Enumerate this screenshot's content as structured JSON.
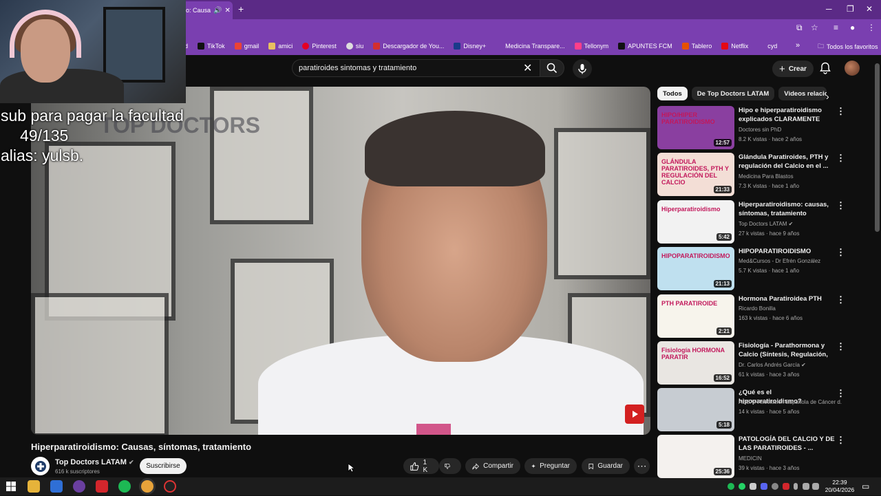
{
  "browser": {
    "tab_title": "o: Causa",
    "bookmarks": [
      "d",
      "TikTok",
      "gmail",
      "amici",
      "Pinterest",
      "siu",
      "Descargador de You...",
      "Disney+",
      "Medicina Transpare...",
      "Tellonym",
      "APUNTES FCM",
      "Tablero",
      "Netflix",
      "cyd"
    ],
    "all_bookmarks": "Todos los favoritos"
  },
  "header": {
    "search_value": "paratiroides sintomas y tratamiento",
    "create_label": "Crear"
  },
  "overlay": {
    "line1": "sub para pagar la facultad",
    "line2": "49/135",
    "line3": "alias: yulsb."
  },
  "video": {
    "watermark": "TOP DOCTORS",
    "title": "Hiperparatiroidismo: Causas, síntomas, tratamiento",
    "channel": "Top Doctors LATAM",
    "subscribers": "616 k suscriptores",
    "subscribe_label": "Suscribirse",
    "likes": "1 K",
    "share_label": "Compartir",
    "ask_label": "Preguntar",
    "save_label": "Guardar"
  },
  "sidebar": {
    "chips": [
      "Todos",
      "De Top Doctors LATAM",
      "Videos relacio"
    ],
    "recommendations": [
      {
        "title": "Hipo e hiperparatiroidismo explicados CLARAMENTE",
        "channel": "Doctores sin PhD",
        "meta": "8.2 K vistas · hace 2 años",
        "duration": "12:57",
        "thumb_text": "HIPO/HIPER PARATIROIDISMO",
        "color": "#8a3fa0"
      },
      {
        "title": "Glándula Paratiroides, PTH y regulación del Calcio en el ...",
        "channel": "Medicina Para Blastos",
        "meta": "7.3 K vistas · hace 1 año",
        "duration": "21:33",
        "thumb_text": "GLÁNDULA PARATIROIDES, PTH Y REGULACIÓN DEL CALCIO",
        "color": "#f3ded6"
      },
      {
        "title": "Hiperparatiroidismo: causas, síntomas, tratamiento",
        "channel": "Top Doctors LATAM",
        "meta": "27 k vistas · hace 9 años",
        "duration": "5:42",
        "thumb_text": "Hiperparatiroidismo",
        "color": "#f2f2f2",
        "verified": true
      },
      {
        "title": "HIPOPARATIROIDISMO",
        "channel": "Med&Cursos - Dr Efrén González",
        "meta": "5.7 K vistas · hace 1 año",
        "duration": "21:13",
        "thumb_text": "HIPOPARATIROIDISMO",
        "color": "#bfe0ef"
      },
      {
        "title": "Hormona Paratiroidea PTH",
        "channel": "Ricardo Bonilla",
        "meta": "163 k vistas · hace 6 años",
        "duration": "2:21",
        "thumb_text": "PTH PARATIROIDE",
        "color": "#f7f4ec"
      },
      {
        "title": "Fisiología - Parathormona y Calcio (Síntesis, Regulación, ...",
        "channel": "Dr. Carlos Andrés García",
        "meta": "61 k vistas · hace 3 años",
        "duration": "16:52",
        "thumb_text": "Fisiología HORMONA PARATIR",
        "color": "#e9e6e2",
        "verified": true
      },
      {
        "title": "¿Qué es el hipoparatiroidismo?",
        "channel": "AECAT Asociación Española de Cáncer d...",
        "meta": "14 k vistas · hace 5 años",
        "duration": "5:18",
        "thumb_text": "",
        "color": "#c7ccd2"
      },
      {
        "title": "PATOLOGÍA DEL CALCIO Y DE LAS PARATIROIDES - ...",
        "channel": "MEDICIN",
        "meta": "39 k vistas · hace 3 años",
        "duration": "25:36",
        "thumb_text": "",
        "color": "#f4f1ee"
      }
    ]
  },
  "taskbar": {
    "time": "22:39",
    "date": "20/04/2026"
  }
}
